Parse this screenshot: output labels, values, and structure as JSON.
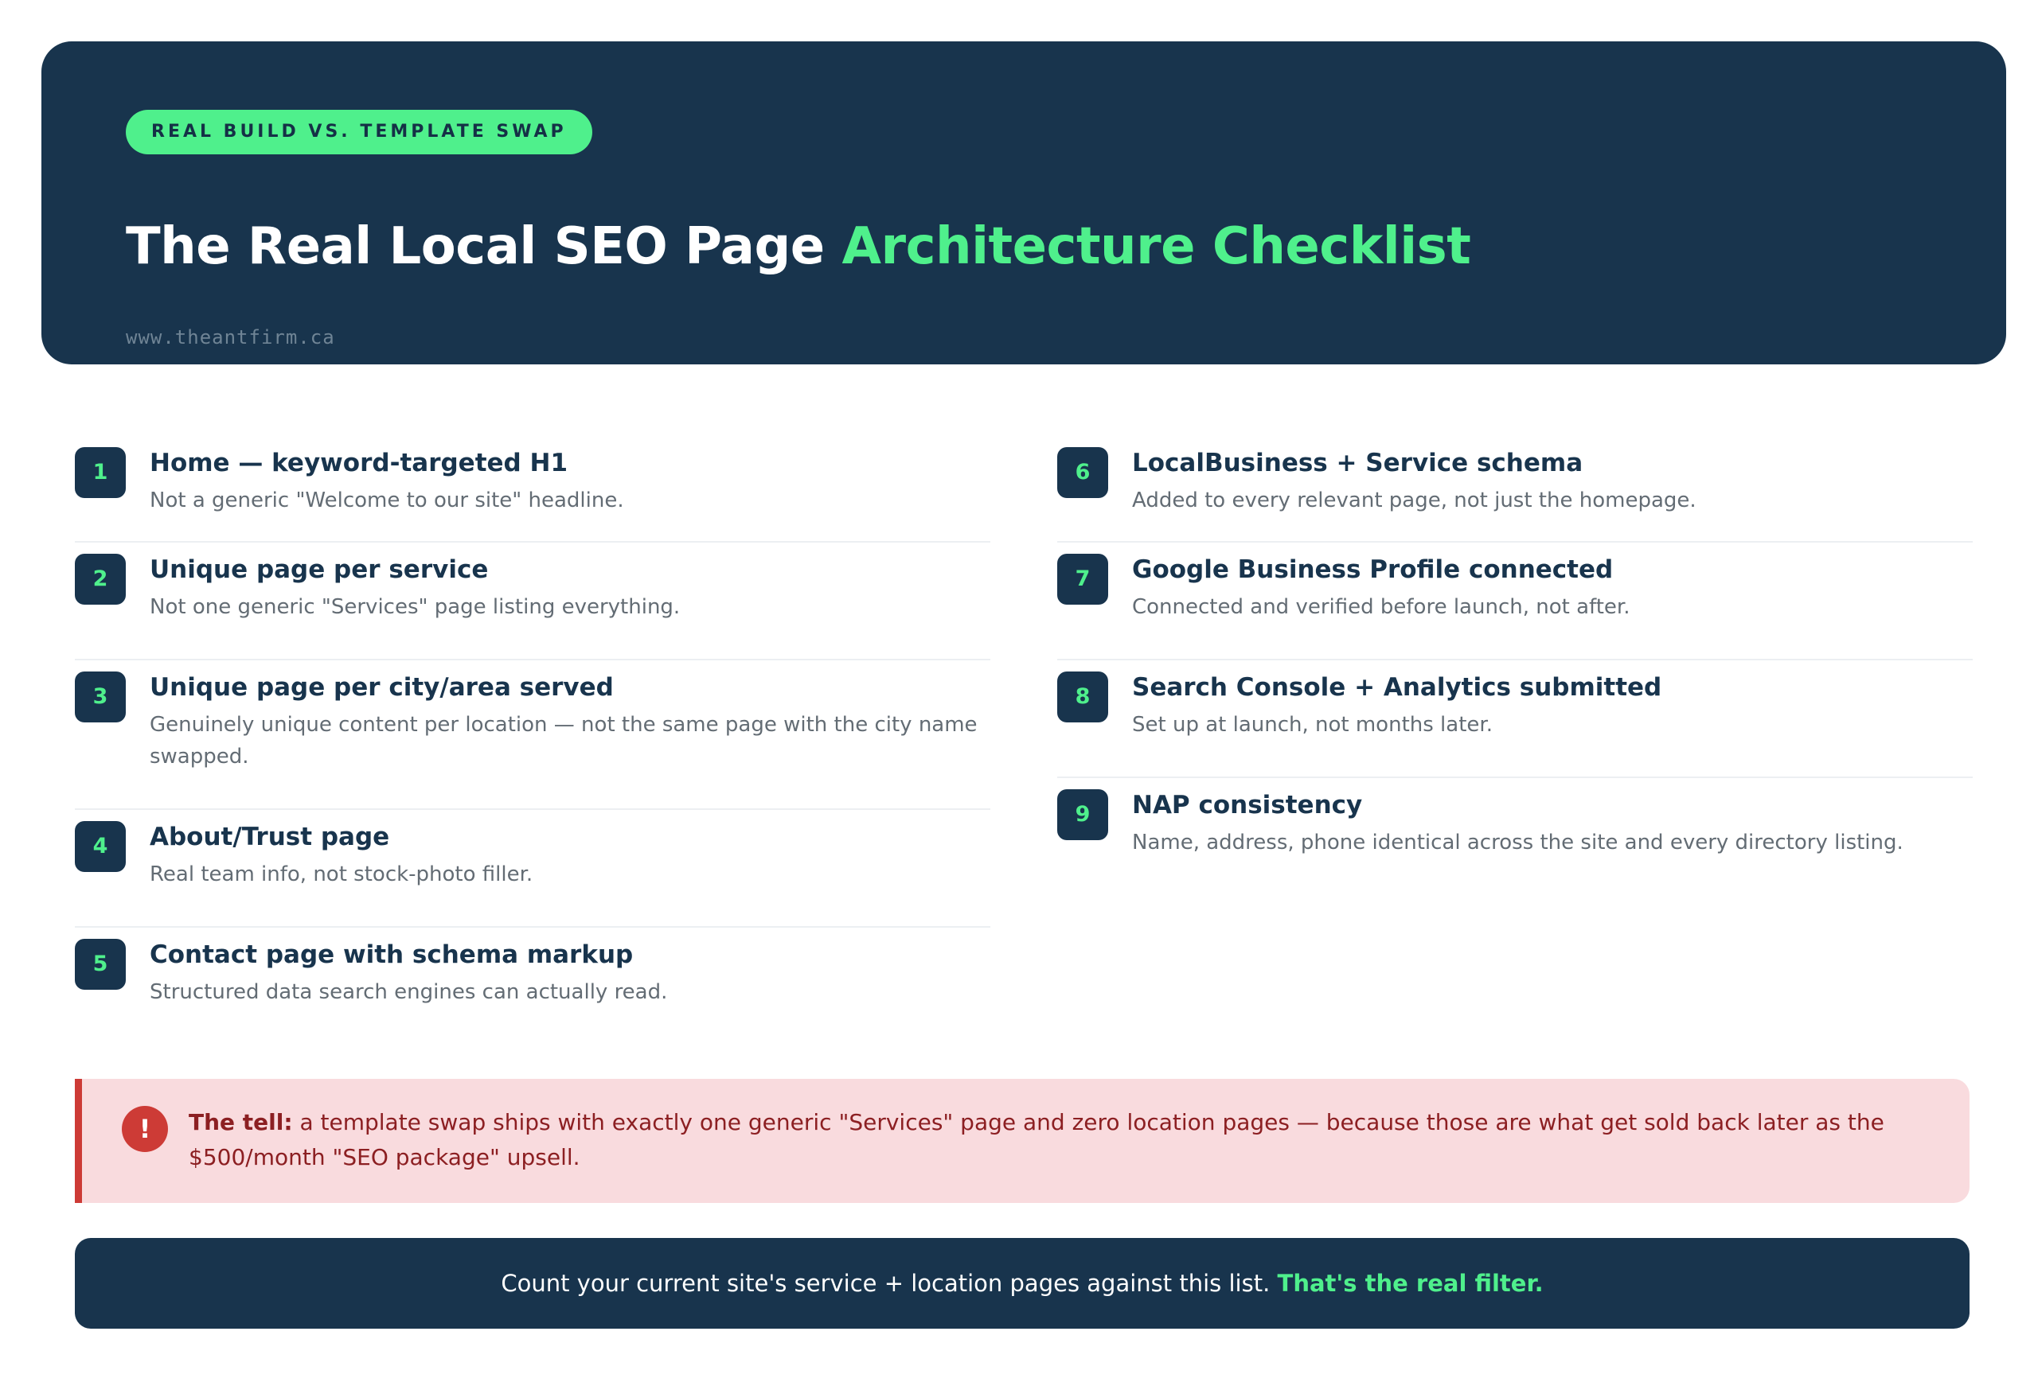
{
  "header": {
    "badge": "REAL BUILD VS. TEMPLATE SWAP",
    "title_main": "The Real Local SEO Page ",
    "title_highlight": "Architecture Checklist",
    "site": "www.theantfirm.ca"
  },
  "checklist": {
    "left": [
      {
        "number": "1",
        "title": "Home — keyword-targeted H1",
        "description": "Not a generic \"Welcome to our site\" headline."
      },
      {
        "number": "2",
        "title": "Unique page per service",
        "description": "Not one generic \"Services\" page listing everything."
      },
      {
        "number": "3",
        "title": "Unique page per city/area served",
        "description": "Genuinely unique content per location — not the same page with the city name swapped."
      },
      {
        "number": "4",
        "title": "About/Trust page",
        "description": "Real team info, not stock-photo filler."
      },
      {
        "number": "5",
        "title": "Contact page with schema markup",
        "description": "Structured data search engines can actually read."
      }
    ],
    "right": [
      {
        "number": "6",
        "title": "LocalBusiness + Service schema",
        "description": "Added to every relevant page, not just the homepage."
      },
      {
        "number": "7",
        "title": "Google Business Profile connected",
        "description": "Connected and verified before launch, not after."
      },
      {
        "number": "8",
        "title": "Search Console + Analytics submitted",
        "description": "Set up at launch, not months later."
      },
      {
        "number": "9",
        "title": "NAP consistency",
        "description": "Name, address, phone identical across the site and every directory listing."
      }
    ]
  },
  "callout": {
    "icon": "exclamation-icon",
    "icon_glyph": "!",
    "lead": "The tell:",
    "text": " a template swap ships with exactly one generic \"Services\" page and zero location pages — because those are what get sold back later as the $500/month \"SEO package\" upsell."
  },
  "footer": {
    "text": "Count your current site's service + location pages against this list. ",
    "highlight": "That's the real filter."
  },
  "colors": {
    "navy": "#18344d",
    "accent_green": "#4ff08c",
    "alert_red": "#cd3b36",
    "alert_bg": "#f9dbde"
  }
}
